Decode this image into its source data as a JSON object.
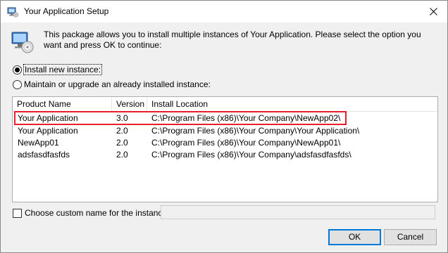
{
  "window": {
    "title": "Your Application Setup",
    "close_icon": "close-icon",
    "app_icon": "setup-computer-icon"
  },
  "description": "This package allows you to install multiple instances of Your Application. Please select the option you want and press OK to continue:",
  "options": {
    "install_new": {
      "label": "Install new instance:",
      "selected": true
    },
    "maintain": {
      "label": "Maintain or upgrade an already installed instance:",
      "selected": false
    }
  },
  "table": {
    "columns": [
      "Product Name",
      "Version",
      "Install Location"
    ],
    "rows": [
      [
        "Your Application",
        "3.0",
        "C:\\Program Files (x86)\\Your Company\\NewApp02\\"
      ],
      [
        "Your Application",
        "2.0",
        "C:\\Program Files (x86)\\Your Company\\Your Application\\"
      ],
      [
        "NewApp01",
        "2.0",
        "C:\\Program Files (x86)\\Your Company\\NewApp01\\"
      ],
      [
        "adsfasdfasfds",
        "2.0",
        "C:\\Program Files (x86)\\Your Company\\adsfasdfasfds\\"
      ]
    ],
    "highlight_color": "#e8202a"
  },
  "custom_name": {
    "label": "Choose custom name for the instance:",
    "checked": false,
    "value": ""
  },
  "buttons": {
    "ok": "OK",
    "cancel": "Cancel"
  },
  "colors": {
    "accent": "#0078d7",
    "highlight": "#e8202a"
  }
}
